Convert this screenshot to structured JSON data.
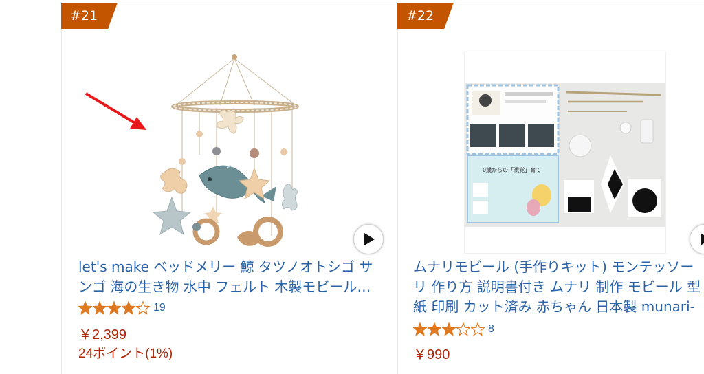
{
  "colors": {
    "badge": "#c45500",
    "link": "#2a63a8",
    "price": "#b12704",
    "star": "#de7921",
    "arrow": "#e8191c"
  },
  "products": [
    {
      "rank": "#21",
      "title_line1": "let's make ベッドメリー 鯨 タツノオトシゴ サ",
      "title_line2": "ンゴ 海の生き物 水中 フェルト 木製モビール…",
      "rating": 4,
      "rating_count": "19",
      "price": "￥2,399",
      "points": "24ポイント(1%)",
      "image": "felt-ocean-baby-mobile-image",
      "play_icon": "play-icon"
    },
    {
      "rank": "#22",
      "title_line1": "ムナリモビール (手作りキット) モンテッソー",
      "title_line2": "リ 作り方 説明書付き ムナリ 制作 モビール 型",
      "title_line3": "紙 印刷 カット済み 赤ちゃん 日本製 munari-",
      "rating": 3,
      "rating_count": "8",
      "price": "￥990",
      "image": "munari-mobile-kit-image",
      "play_icon": "play-icon",
      "kit_text": "0歳からの「視覚」育て"
    }
  ],
  "annotation": "red-arrow-icon"
}
